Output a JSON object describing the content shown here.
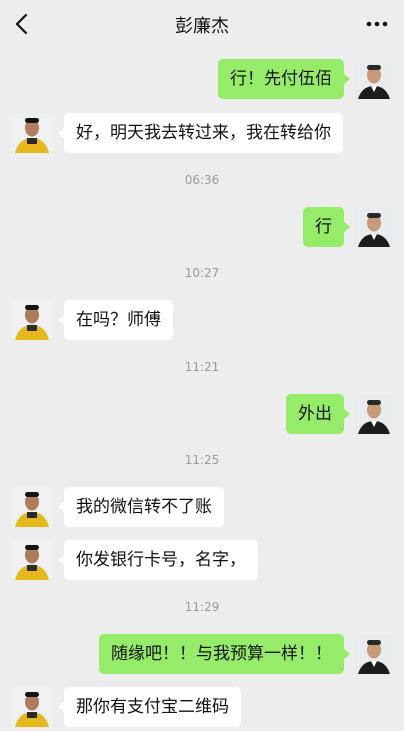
{
  "header": {
    "title": "彭廉杰"
  },
  "messages": [
    {
      "sender": "self",
      "text": "行！先付伍佰"
    },
    {
      "sender": "other",
      "text": "好，明天我去转过来，我在转给你"
    },
    {
      "time": "06:36"
    },
    {
      "sender": "self",
      "text": "行"
    },
    {
      "time": "10:27"
    },
    {
      "sender": "other",
      "text": "在吗？师傅"
    },
    {
      "time": "11:21"
    },
    {
      "sender": "self",
      "text": "外出"
    },
    {
      "time": "11:25"
    },
    {
      "sender": "other",
      "text": "我的微信转不了账"
    },
    {
      "sender": "other",
      "text": "你发银行卡号，名字，"
    },
    {
      "time": "11:29"
    },
    {
      "sender": "self",
      "text": "随缘吧！！与我预算一样！！"
    },
    {
      "sender": "other",
      "text": "那你有支付宝二维码"
    }
  ],
  "colors": {
    "self_bubble": "#95ec69",
    "other_bubble": "#ffffff",
    "background": "#ededed"
  },
  "icons": {
    "back": "chevron-left-icon",
    "more": "more-dots-icon"
  }
}
